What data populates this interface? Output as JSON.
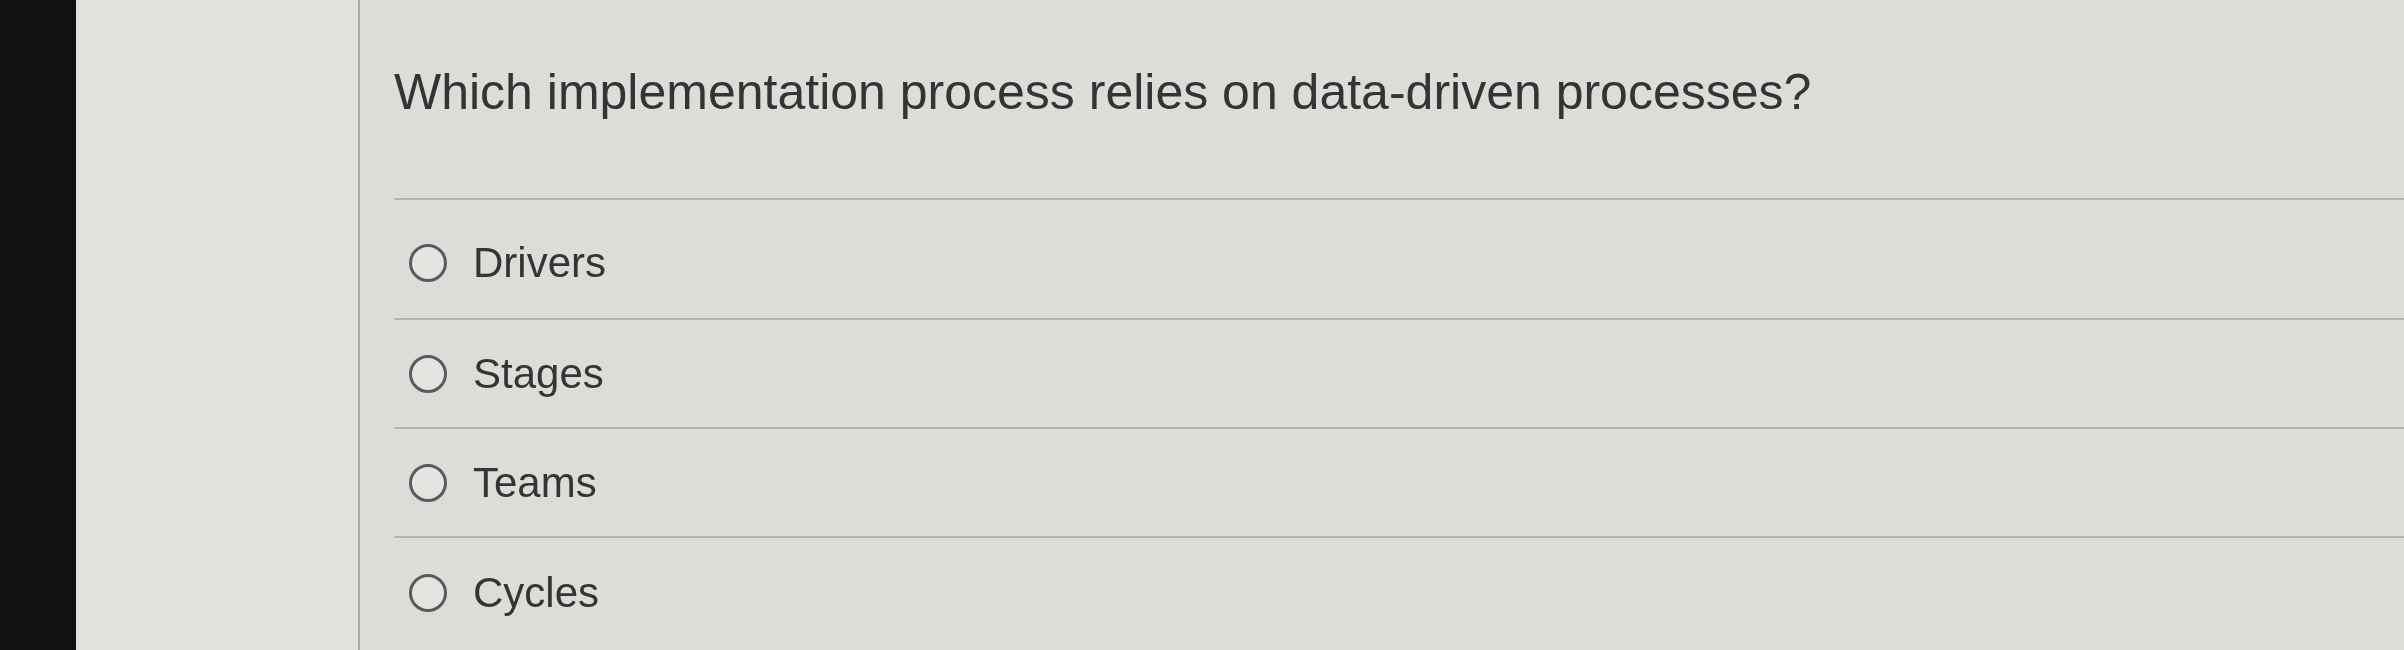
{
  "question": "Which implementation process relies on data-driven processes?",
  "options": [
    {
      "label": "Drivers",
      "selected": false
    },
    {
      "label": "Stages",
      "selected": false
    },
    {
      "label": "Teams",
      "selected": false
    },
    {
      "label": "Cycles",
      "selected": false
    }
  ]
}
